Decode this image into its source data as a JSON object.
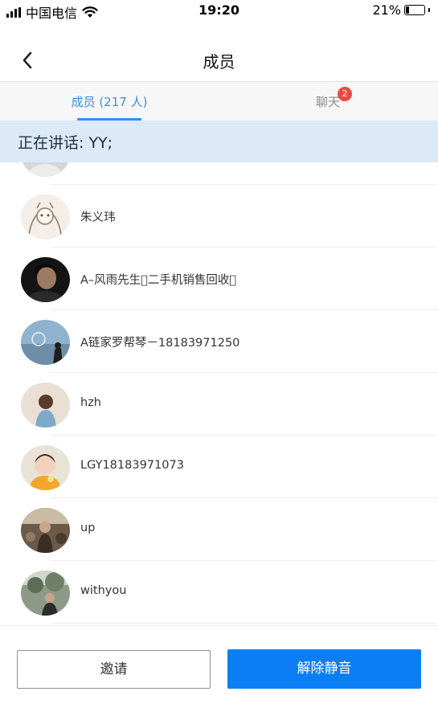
{
  "status_bar": {
    "carrier": "中国电信",
    "time": "19:20",
    "battery_percent": "21%",
    "battery_level": 0.21,
    "icons": [
      "signal-icon",
      "wifi-icon",
      "battery-icon"
    ]
  },
  "nav": {
    "title": "成员",
    "back_icon": "chevron-left-icon"
  },
  "tabs": [
    {
      "label": "成员 (217 人)",
      "active": true
    },
    {
      "label": "聊天",
      "active": false,
      "badge": "2"
    }
  ],
  "speaking": {
    "text": "正在讲话: YY;"
  },
  "members": [
    {
      "name": ""
    },
    {
      "name": "朱义玮"
    },
    {
      "name": "A–风雨先生二手机销售回收"
    },
    {
      "name": "A链家罗帮琴－18183971250"
    },
    {
      "name": "hzh"
    },
    {
      "name": "LGY18183971073"
    },
    {
      "name": "up"
    },
    {
      "name": "withyou"
    }
  ],
  "actions": {
    "invite_label": "邀请",
    "unmute_label": "解除静音"
  },
  "colors": {
    "accent": "#3d8bec",
    "primary_button": "#0a7ff5",
    "banner_bg": "#dbe9f8",
    "badge": "#f0473f"
  }
}
